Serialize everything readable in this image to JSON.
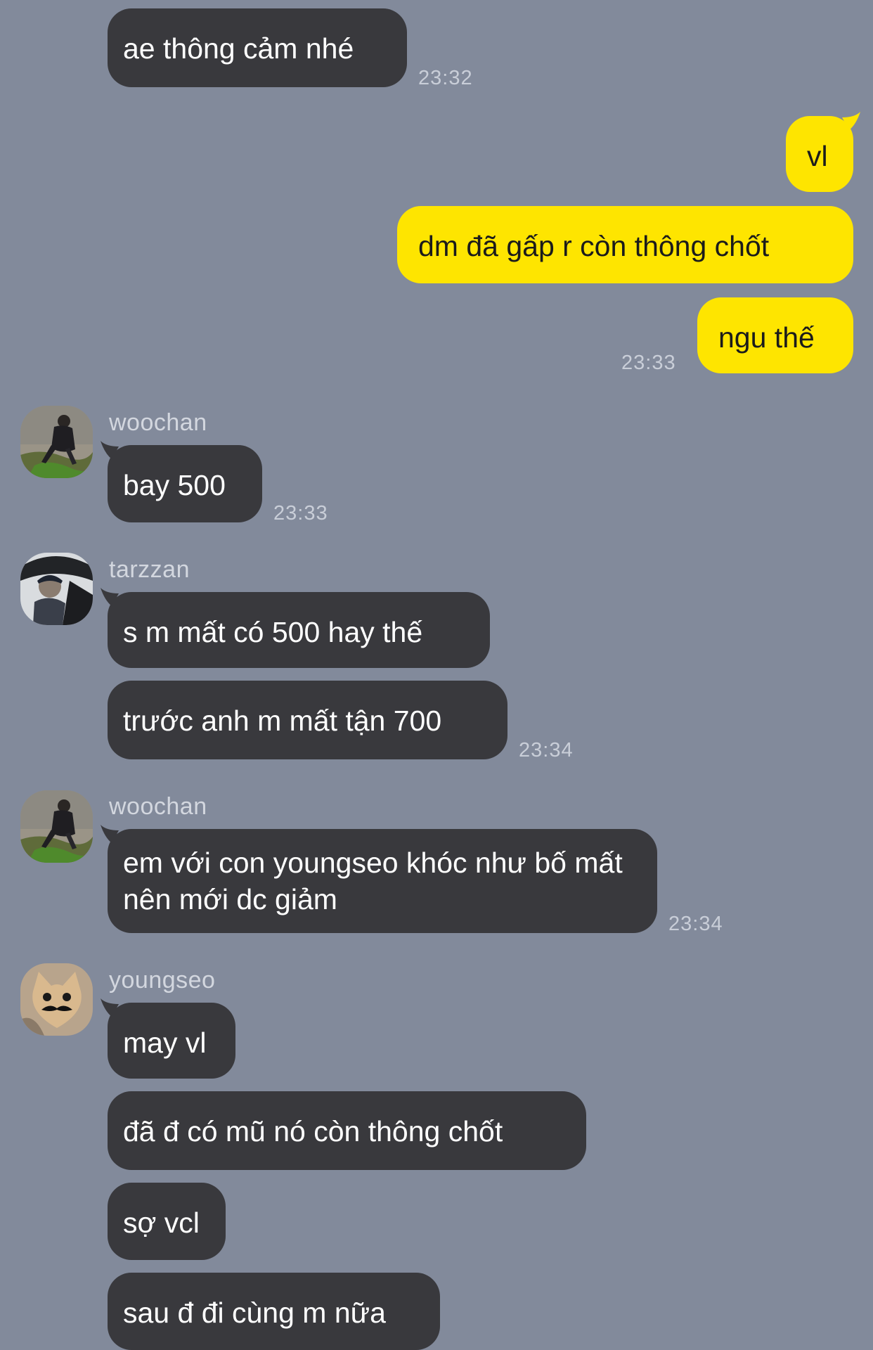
{
  "messages": [
    {
      "sender": "",
      "text": "ae thông cảm nhé",
      "time": "23:32"
    },
    {
      "sender": "me",
      "text": "vl",
      "time": ""
    },
    {
      "sender": "me",
      "text": "dm đã gấp r còn thông chốt",
      "time": ""
    },
    {
      "sender": "me",
      "text": "ngu thế",
      "time": "23:33"
    },
    {
      "sender": "woochan",
      "text": "bay 500",
      "time": "23:33"
    },
    {
      "sender": "tarzzan",
      "text": "s m mất có 500 hay thế",
      "time": ""
    },
    {
      "sender": "tarzzan",
      "text": "trước anh m mất tận 700",
      "time": "23:34"
    },
    {
      "sender": "woochan",
      "text": "em với con youngseo khóc như bố mất nên mới dc giảm",
      "time": "23:34"
    },
    {
      "sender": "youngseo",
      "text": "may vl",
      "time": ""
    },
    {
      "sender": "youngseo",
      "text": "đã đ có mũ nó còn thông chốt",
      "time": ""
    },
    {
      "sender": "youngseo",
      "text": "sợ vcl",
      "time": ""
    },
    {
      "sender": "youngseo",
      "text": "sau đ đi cùng m nữa",
      "time": ""
    }
  ],
  "avatars": [
    {
      "sender": "woochan",
      "icon": "person-photo-avatar"
    },
    {
      "sender": "tarzzan",
      "icon": "person-photo-avatar"
    },
    {
      "sender": "woochan",
      "icon": "person-photo-avatar"
    },
    {
      "sender": "youngseo",
      "icon": "cat-mustache-avatar"
    }
  ],
  "colors": {
    "background": "#828a9b",
    "incoming_bubble": "#39393d",
    "outgoing_bubble": "#fee500"
  }
}
